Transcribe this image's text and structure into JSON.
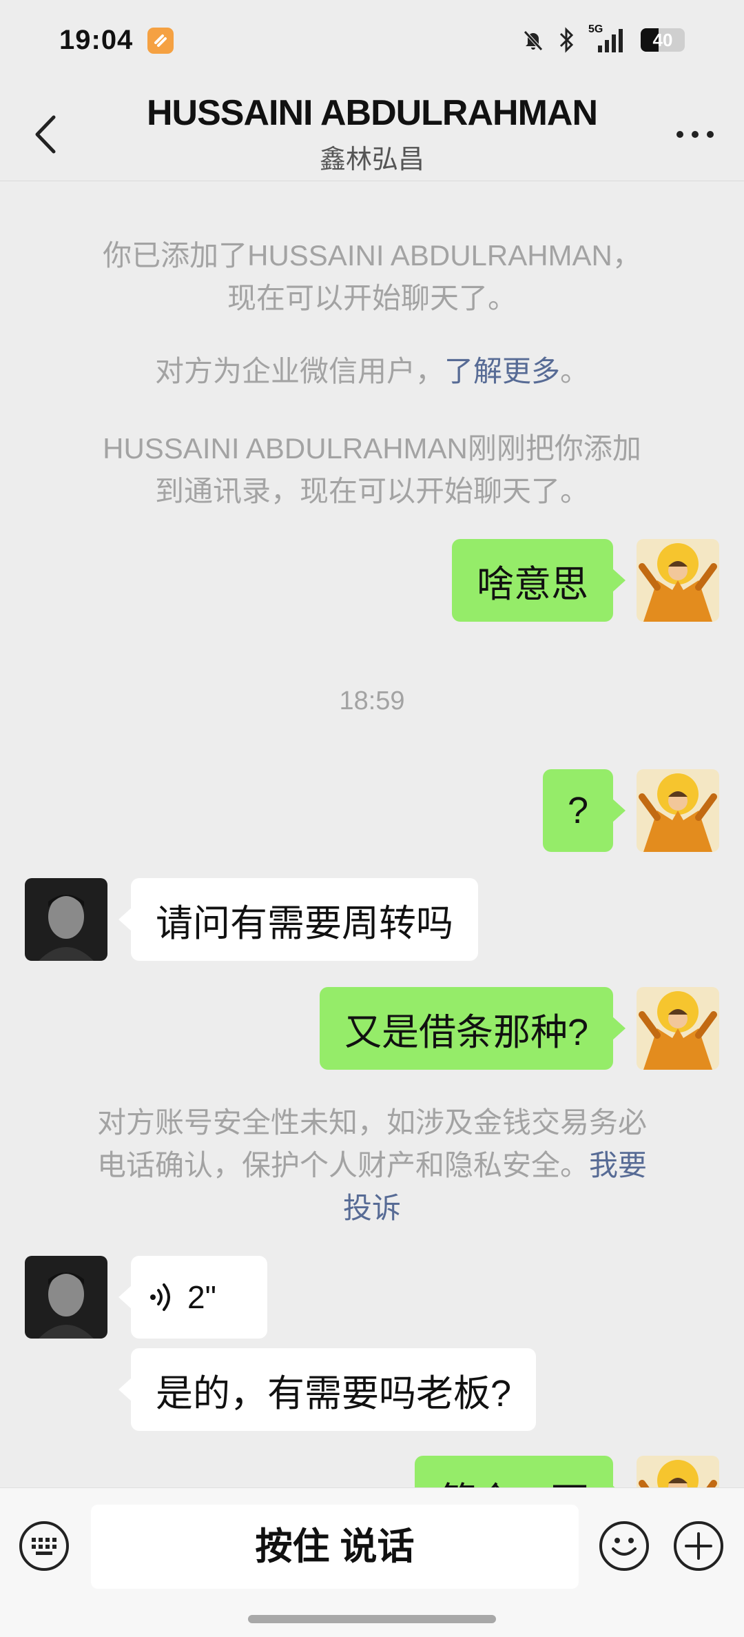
{
  "status_bar": {
    "time": "19:04",
    "network": "5G",
    "battery": "40",
    "battery_level": 0.4
  },
  "header": {
    "title": "HUSSAINI ABDULRAHMAN",
    "subtitle": "鑫林弘昌",
    "back_icon": "chevron-left-icon",
    "more_icon": "more-icon"
  },
  "system_messages": {
    "added_line1": "你已添加了HUSSAINI ABDULRAHMAN，",
    "added_line2": "现在可以开始聊天了。",
    "enterprise_text": "对方为企业微信用户，",
    "enterprise_link": "了解更多",
    "enterprise_end": "。",
    "added_you_line1": "HUSSAINI ABDULRAHMAN刚刚把你添加",
    "added_you_line2": "到通讯录，现在可以开始聊天了。",
    "warning_line1": "对方账号安全性未知，如涉及金钱交易务必",
    "warning_line2": "电话确认，保护个人财产和隐私安全。",
    "warning_link1": "我要",
    "warning_link2": "投诉"
  },
  "timestamp": "18:59",
  "messages": [
    {
      "side": "out",
      "text": "啥意思"
    },
    {
      "side": "out",
      "text": "?"
    },
    {
      "side": "in",
      "text": "请问有需要周转吗"
    },
    {
      "side": "out",
      "text": "又是借条那种?"
    },
    {
      "side": "in",
      "type": "voice",
      "text": "2\""
    },
    {
      "side": "in",
      "text": "是的，有需要吗老板?"
    },
    {
      "side": "out",
      "text": "简介一下"
    }
  ],
  "bottom_bar": {
    "hold_to_talk": "按住 说话",
    "keyboard_icon": "keyboard-icon",
    "emoji_icon": "emoji-icon",
    "plus_icon": "plus-icon"
  },
  "colors": {
    "background": "#ededed",
    "outgoing_bubble": "#95ec69",
    "incoming_bubble": "#ffffff",
    "link": "#576b95",
    "system_text": "#a3a3a3"
  }
}
